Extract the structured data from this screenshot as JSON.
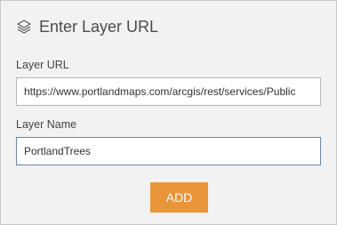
{
  "header": {
    "title": "Enter Layer URL",
    "icon": "layers-icon"
  },
  "form": {
    "url_label": "Layer URL",
    "url_value": "https://www.portlandmaps.com/arcgis/rest/services/Public",
    "name_label": "Layer Name",
    "name_value": "PortlandTrees"
  },
  "actions": {
    "add_label": "ADD"
  },
  "colors": {
    "panel_bg": "#f2f2f2",
    "accent": "#e9953a",
    "focus_border": "#6e86a3"
  }
}
